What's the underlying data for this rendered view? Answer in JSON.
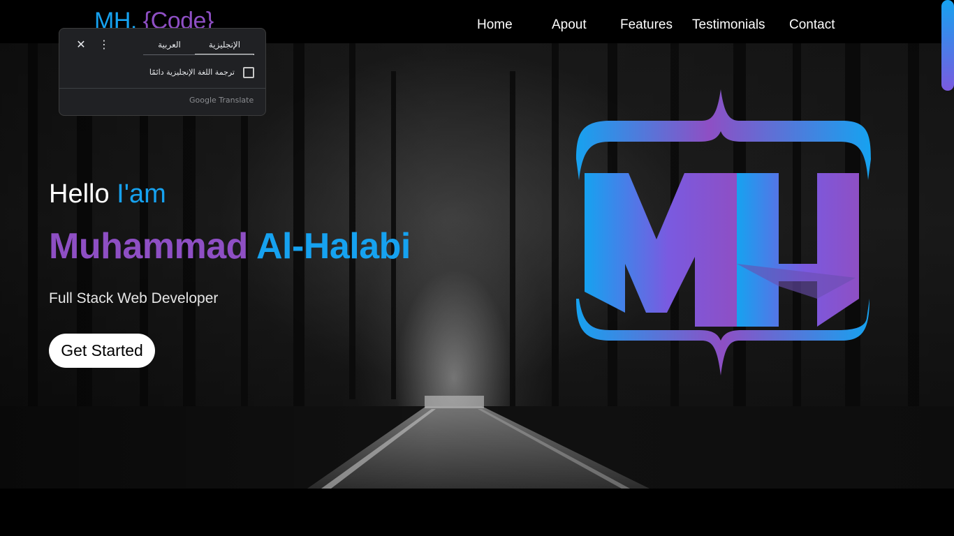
{
  "header": {
    "brand_mh": "MH.",
    "brand_code": "{Code}",
    "nav": [
      "Home",
      "Apout",
      "Features",
      "Testimonials",
      "Contact"
    ]
  },
  "hero": {
    "hello": "Hello",
    "hello_highlight": "I'am",
    "name_first": "Muhammad",
    "name_last": "Al-Halabi",
    "role": "Full Stack Web Developer",
    "cta": "Get Started",
    "logo_letters": "MH"
  },
  "translate_popup": {
    "tab_english": "الإنجليزية",
    "tab_arabic": "العربية",
    "always_translate": "ترجمة اللغة الإنجليزية دائمًا",
    "footer": "Google Translate",
    "close_icon": "close-icon",
    "more_icon": "more-vert-icon"
  },
  "colors": {
    "blue": "#16a2f0",
    "purple": "#8e4fc4",
    "background": "#000000"
  }
}
